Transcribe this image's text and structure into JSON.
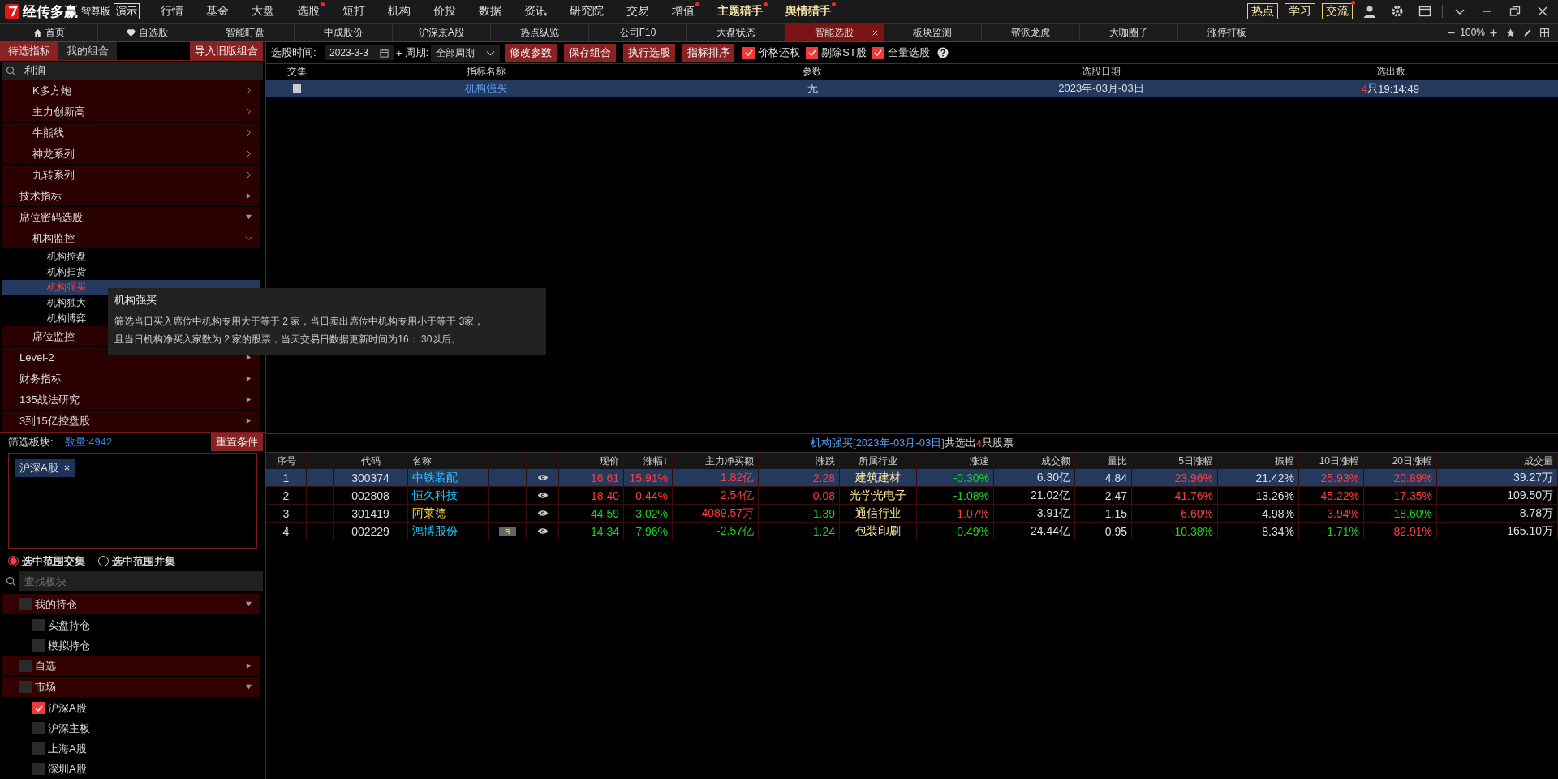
{
  "app": {
    "name": "经传多赢",
    "edition": "智尊版",
    "badge": "演示"
  },
  "menu": [
    {
      "label": "行情",
      "dot": false,
      "emphasized": false
    },
    {
      "label": "基金",
      "dot": false,
      "emphasized": false
    },
    {
      "label": "大盘",
      "dot": false,
      "emphasized": false
    },
    {
      "label": "选股",
      "dot": true,
      "emphasized": false
    },
    {
      "label": "短打",
      "dot": false,
      "emphasized": false
    },
    {
      "label": "机构",
      "dot": false,
      "emphasized": false
    },
    {
      "label": "价投",
      "dot": false,
      "emphasized": false
    },
    {
      "label": "数据",
      "dot": false,
      "emphasized": false
    },
    {
      "label": "资讯",
      "dot": false,
      "emphasized": false
    },
    {
      "label": "研究院",
      "dot": false,
      "emphasized": false
    },
    {
      "label": "交易",
      "dot": false,
      "emphasized": false
    },
    {
      "label": "增值",
      "dot": true,
      "emphasized": false
    },
    {
      "label": "主题猎手",
      "dot": true,
      "emphasized": true
    },
    {
      "label": "舆情猎手",
      "dot": true,
      "emphasized": true
    }
  ],
  "quick_buttons": [
    {
      "label": "热点",
      "dot": false
    },
    {
      "label": "学习",
      "dot": false
    },
    {
      "label": "交流",
      "dot": true
    }
  ],
  "tabs": [
    {
      "label": "首页",
      "kind": "home",
      "selected": false
    },
    {
      "label": "自选股",
      "kind": "favorites",
      "selected": false
    },
    {
      "label": "智能盯盘",
      "kind": "plain",
      "selected": false
    },
    {
      "label": "中成股份",
      "kind": "plain",
      "selected": false
    },
    {
      "label": "沪深京A股",
      "kind": "plain",
      "selected": false
    },
    {
      "label": "热点纵览",
      "kind": "plain",
      "selected": false
    },
    {
      "label": "公司F10",
      "kind": "plain",
      "selected": false
    },
    {
      "label": "大盘状态",
      "kind": "plain",
      "selected": false
    },
    {
      "label": "智能选股",
      "kind": "plain",
      "selected": true
    },
    {
      "label": "板块监测",
      "kind": "plain",
      "selected": false
    },
    {
      "label": "帮派龙虎",
      "kind": "plain",
      "selected": false
    },
    {
      "label": "大咖圈子",
      "kind": "plain",
      "selected": false
    },
    {
      "label": "涨停打板",
      "kind": "plain",
      "selected": false
    }
  ],
  "zoom": "100%",
  "indicator_panel": {
    "tabs": [
      {
        "label": "待选指标",
        "selected": true
      },
      {
        "label": "我的组合",
        "selected": false
      }
    ],
    "import_button": "导入旧版组合",
    "search": "利润",
    "continued_items": [
      {
        "label": "K多方炮"
      },
      {
        "label": "主力创新高"
      },
      {
        "label": "牛熊线"
      },
      {
        "label": "神龙系列"
      },
      {
        "label": "九转系列"
      }
    ],
    "items": [
      {
        "label": "技术指标",
        "expanded": false
      },
      {
        "label": "席位密码选股",
        "expanded": true,
        "children": [
          {
            "label": "机构监控",
            "expanded": true,
            "children": [
              {
                "label": "机构控盘",
                "selected": false
              },
              {
                "label": "机构扫货",
                "selected": false
              },
              {
                "label": "机构强买",
                "selected": true
              },
              {
                "label": "机构独大",
                "selected": false
              },
              {
                "label": "机构博弈",
                "selected": false
              }
            ]
          },
          {
            "label": "席位监控",
            "expanded": false
          }
        ]
      },
      {
        "label": "Level-2",
        "expanded": false
      },
      {
        "label": "财务指标",
        "expanded": false
      },
      {
        "label": "135战法研究",
        "expanded": false
      },
      {
        "label": "3到15亿控盘股",
        "expanded": false
      }
    ]
  },
  "tooltip": {
    "title": "机构强买",
    "lines": [
      "筛选当日买入席位中机构专用大于等于 2 家，当日卖出席位中机构专用小于等于 3家，",
      "且当日机构净买入家数为 2 家的股票，当天交易日数据更新时间为16：:30以后。"
    ]
  },
  "sector_filter": {
    "label": "筛选板块:",
    "count": "数量:4942",
    "reset_button": "重置条件",
    "tags": [
      "沪深A股"
    ],
    "modes": [
      {
        "label": "选中范围交集",
        "selected": true
      },
      {
        "label": "选中范围并集",
        "selected": false
      }
    ],
    "search_placeholder": "查找板块",
    "groups": [
      {
        "label": "我的持仓",
        "checked": false,
        "expanded": true,
        "children": [
          {
            "label": "实盘持仓",
            "checked": false
          },
          {
            "label": "模拟持仓",
            "checked": false
          }
        ]
      },
      {
        "label": "自选",
        "checked": false,
        "expanded": false
      },
      {
        "label": "市场",
        "checked": false,
        "expanded": true,
        "children": [
          {
            "label": "沪深A股",
            "checked": true
          },
          {
            "label": "沪深主板",
            "checked": false
          },
          {
            "label": "上海A股",
            "checked": false
          },
          {
            "label": "深圳A股",
            "checked": false
          }
        ]
      }
    ]
  },
  "toolbar": {
    "time_label": "选股时间:",
    "minus": "-",
    "date": "2023-3-3",
    "plus": "+",
    "period_label": "周期:",
    "period": "全部周期",
    "buttons": [
      "修改参数",
      "保存组合",
      "执行选股",
      "指标排序"
    ],
    "checks": [
      {
        "label": "价格还权",
        "checked": true
      },
      {
        "label": "剔除ST股",
        "checked": true
      },
      {
        "label": "全量选股",
        "checked": true
      }
    ]
  },
  "conditions": {
    "columns": [
      "交集",
      "指标名称",
      "参数",
      "选股日期",
      "选出数"
    ],
    "rows": [
      {
        "checked": false,
        "selected": true,
        "name": "机构强买",
        "params": "无",
        "date": "2023年-03月-03日",
        "count": "4",
        "count_unit": "只",
        "time": "19:14:49"
      }
    ]
  },
  "results": {
    "title": "机构强买[2023年-03月-03日]",
    "summary_prefix": "共选出",
    "count": "4",
    "summary_suffix": "只股票",
    "columns": [
      "序号",
      "",
      "代码",
      "名称",
      "",
      "",
      "现价",
      "涨幅↓",
      "主力净买额",
      "涨跌",
      "所属行业",
      "涨速",
      "成交额",
      "量比",
      "5日涨幅",
      "振幅",
      "10日涨幅",
      "20日涨幅",
      "成交量"
    ],
    "rows": [
      {
        "selected": true,
        "cells": [
          {
            "text": "1",
            "kind": "plain"
          },
          {
            "text": "",
            "kind": "plain"
          },
          {
            "text": "300374",
            "kind": "plain"
          },
          {
            "text": "中铁装配",
            "kind": "link"
          },
          {
            "text": "",
            "kind": "plain"
          },
          {
            "kind": "eye"
          },
          {
            "text": "16.61",
            "kind": "rise"
          },
          {
            "text": "15.91%",
            "kind": "rise"
          },
          {
            "text": "1.82亿",
            "kind": "rise"
          },
          {
            "text": "2.28",
            "kind": "rise"
          },
          {
            "text": "建筑建材",
            "kind": "industry"
          },
          {
            "text": "-0.30%",
            "kind": "fall"
          },
          {
            "text": "6.30亿",
            "kind": "plain"
          },
          {
            "text": "4.84",
            "kind": "plain"
          },
          {
            "text": "23.96%",
            "kind": "rise"
          },
          {
            "text": "21.42%",
            "kind": "plain"
          },
          {
            "text": "25.93%",
            "kind": "rise"
          },
          {
            "text": "20.89%",
            "kind": "rise"
          },
          {
            "text": "39.27万",
            "kind": "plain"
          }
        ]
      },
      {
        "selected": false,
        "cells": [
          {
            "text": "2",
            "kind": "plain"
          },
          {
            "text": "",
            "kind": "plain"
          },
          {
            "text": "002808",
            "kind": "plain"
          },
          {
            "text": "恒久科技",
            "kind": "link"
          },
          {
            "text": "",
            "kind": "plain"
          },
          {
            "kind": "eye"
          },
          {
            "text": "18.40",
            "kind": "rise"
          },
          {
            "text": "0.44%",
            "kind": "rise"
          },
          {
            "text": "2.54亿",
            "kind": "rise"
          },
          {
            "text": "0.08",
            "kind": "rise"
          },
          {
            "text": "光学光电子",
            "kind": "industry"
          },
          {
            "text": "-1.08%",
            "kind": "fall"
          },
          {
            "text": "21.02亿",
            "kind": "plain"
          },
          {
            "text": "2.47",
            "kind": "plain"
          },
          {
            "text": "41.76%",
            "kind": "rise"
          },
          {
            "text": "13.26%",
            "kind": "plain"
          },
          {
            "text": "45.22%",
            "kind": "rise"
          },
          {
            "text": "17.35%",
            "kind": "rise"
          },
          {
            "text": "109.50万",
            "kind": "plain"
          }
        ]
      },
      {
        "selected": false,
        "cells": [
          {
            "text": "3",
            "kind": "plain"
          },
          {
            "text": "",
            "kind": "plain"
          },
          {
            "text": "301419",
            "kind": "plain"
          },
          {
            "text": "阿莱德",
            "kind": "highlight"
          },
          {
            "text": "",
            "kind": "plain"
          },
          {
            "kind": "eye"
          },
          {
            "text": "44.59",
            "kind": "fall"
          },
          {
            "text": "-3.02%",
            "kind": "fall"
          },
          {
            "text": "4089.57万",
            "kind": "rise"
          },
          {
            "text": "-1.39",
            "kind": "fall"
          },
          {
            "text": "通信行业",
            "kind": "industry"
          },
          {
            "text": "1.07%",
            "kind": "rise"
          },
          {
            "text": "3.91亿",
            "kind": "plain"
          },
          {
            "text": "1.15",
            "kind": "plain"
          },
          {
            "text": "6.60%",
            "kind": "rise"
          },
          {
            "text": "4.98%",
            "kind": "plain"
          },
          {
            "text": "3.94%",
            "kind": "rise"
          },
          {
            "text": "-18.60%",
            "kind": "fall"
          },
          {
            "text": "8.78万",
            "kind": "plain"
          }
        ]
      },
      {
        "selected": false,
        "cells": [
          {
            "text": "4",
            "kind": "plain"
          },
          {
            "text": "",
            "kind": "plain"
          },
          {
            "text": "002229",
            "kind": "plain"
          },
          {
            "text": "鸿博股份",
            "kind": "link"
          },
          {
            "text": "R",
            "kind": "badge"
          },
          {
            "kind": "eye"
          },
          {
            "text": "14.34",
            "kind": "fall"
          },
          {
            "text": "-7.96%",
            "kind": "fall"
          },
          {
            "text": "-2.57亿",
            "kind": "fall"
          },
          {
            "text": "-1.24",
            "kind": "fall"
          },
          {
            "text": "包装印刷",
            "kind": "industry"
          },
          {
            "text": "-0.49%",
            "kind": "fall"
          },
          {
            "text": "24.44亿",
            "kind": "plain"
          },
          {
            "text": "0.95",
            "kind": "plain"
          },
          {
            "text": "-10.38%",
            "kind": "fall"
          },
          {
            "text": "8.34%",
            "kind": "plain"
          },
          {
            "text": "-1.71%",
            "kind": "fall"
          },
          {
            "text": "82.91%",
            "kind": "rise"
          },
          {
            "text": "165.10万",
            "kind": "plain"
          }
        ]
      }
    ]
  }
}
